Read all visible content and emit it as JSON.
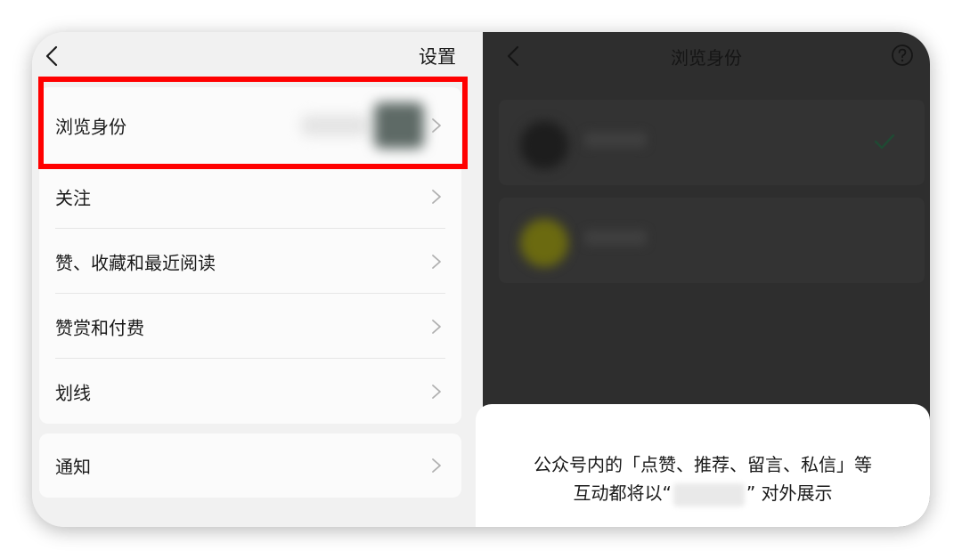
{
  "settings_panel": {
    "title": "设置",
    "back_icon": "chevron-left-icon",
    "rows": [
      {
        "label": "浏览身份"
      },
      {
        "label": "关注"
      },
      {
        "label": "赞、收藏和最近阅读"
      },
      {
        "label": "赞赏和付费"
      },
      {
        "label": "划线"
      }
    ],
    "notify_row": {
      "label": "通知"
    },
    "row_icon": "chevron-right-icon",
    "highlight_color": "#ff0000"
  },
  "identity_panel": {
    "title": "浏览身份",
    "back_icon": "chevron-left-icon",
    "help_icon": "question-circle-icon",
    "selected_icon": "checkmark-icon",
    "overlay_color": "#2e2e2e"
  },
  "bottom_sheet": {
    "line1": "公众号内的「点赞、推荐、留言、私信」等",
    "line2_prefix": "互动都将以“",
    "line2_suffix": "” 对外展示"
  }
}
